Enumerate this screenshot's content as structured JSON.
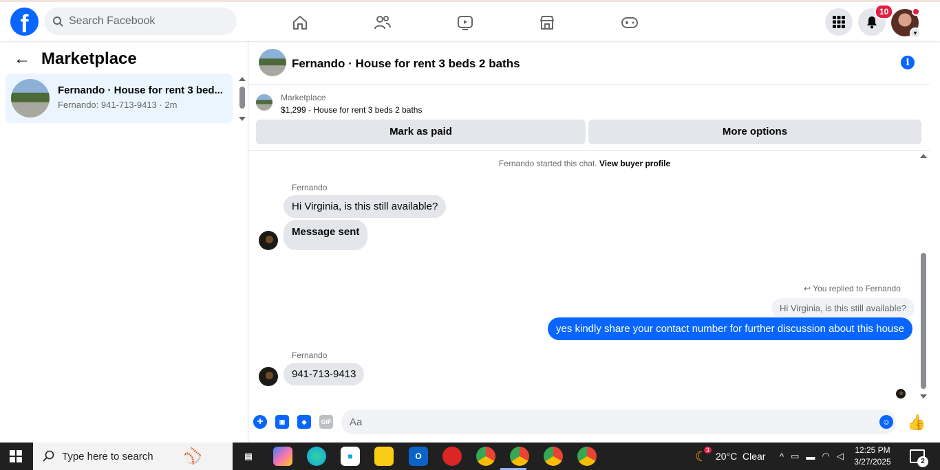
{
  "header": {
    "search_placeholder": "Search Facebook",
    "notifications_count": "10",
    "brand_color": "#0866ff"
  },
  "sidebar": {
    "title": "Marketplace",
    "conversations": [
      {
        "title": "Fernando · House for rent 3 bed...",
        "subtitle": "Fernando: 941-713-9413 · 2m"
      }
    ]
  },
  "chat": {
    "title": "Fernando · House for rent 3 beds 2 baths",
    "listing": {
      "label": "Marketplace",
      "price_title": "$1,299 - House for rent 3 beds 2 baths",
      "mark_paid": "Mark as paid",
      "more_options": "More options"
    },
    "system": {
      "started": "Fernando started this chat.",
      "link": "View buyer profile"
    },
    "messages": {
      "sender1": "Fernando",
      "m1": "Hi Virginia, is this still available?",
      "m2": "Message sent",
      "reply_note": "You replied to Fernando",
      "quote": "Hi Virginia, is this still available?",
      "out1": "yes kindly share your contact number for further discussion about this house",
      "sender2": "Fernando",
      "m3": "941-713-9413"
    },
    "composer": {
      "placeholder": "Aa",
      "gif_label": "GIF"
    }
  },
  "taskbar": {
    "search_placeholder": "Type here to search",
    "weather": "20°C  Clear",
    "weather_badge": "3",
    "time": "12:25 PM",
    "date": "3/27/2025",
    "notifications": "2"
  }
}
